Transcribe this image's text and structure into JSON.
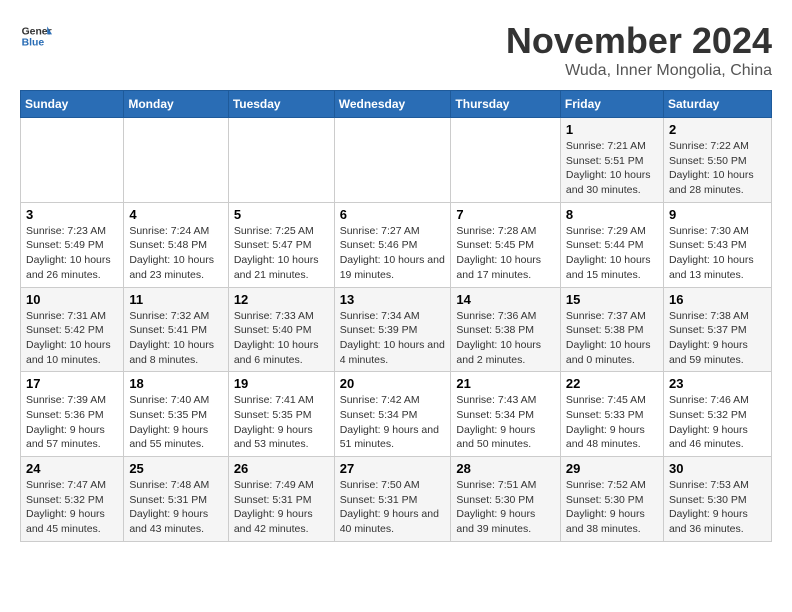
{
  "header": {
    "logo_line1": "General",
    "logo_line2": "Blue",
    "month": "November 2024",
    "location": "Wuda, Inner Mongolia, China"
  },
  "weekdays": [
    "Sunday",
    "Monday",
    "Tuesday",
    "Wednesday",
    "Thursday",
    "Friday",
    "Saturday"
  ],
  "weeks": [
    [
      {
        "day": "",
        "info": ""
      },
      {
        "day": "",
        "info": ""
      },
      {
        "day": "",
        "info": ""
      },
      {
        "day": "",
        "info": ""
      },
      {
        "day": "",
        "info": ""
      },
      {
        "day": "1",
        "info": "Sunrise: 7:21 AM\nSunset: 5:51 PM\nDaylight: 10 hours and 30 minutes."
      },
      {
        "day": "2",
        "info": "Sunrise: 7:22 AM\nSunset: 5:50 PM\nDaylight: 10 hours and 28 minutes."
      }
    ],
    [
      {
        "day": "3",
        "info": "Sunrise: 7:23 AM\nSunset: 5:49 PM\nDaylight: 10 hours and 26 minutes."
      },
      {
        "day": "4",
        "info": "Sunrise: 7:24 AM\nSunset: 5:48 PM\nDaylight: 10 hours and 23 minutes."
      },
      {
        "day": "5",
        "info": "Sunrise: 7:25 AM\nSunset: 5:47 PM\nDaylight: 10 hours and 21 minutes."
      },
      {
        "day": "6",
        "info": "Sunrise: 7:27 AM\nSunset: 5:46 PM\nDaylight: 10 hours and 19 minutes."
      },
      {
        "day": "7",
        "info": "Sunrise: 7:28 AM\nSunset: 5:45 PM\nDaylight: 10 hours and 17 minutes."
      },
      {
        "day": "8",
        "info": "Sunrise: 7:29 AM\nSunset: 5:44 PM\nDaylight: 10 hours and 15 minutes."
      },
      {
        "day": "9",
        "info": "Sunrise: 7:30 AM\nSunset: 5:43 PM\nDaylight: 10 hours and 13 minutes."
      }
    ],
    [
      {
        "day": "10",
        "info": "Sunrise: 7:31 AM\nSunset: 5:42 PM\nDaylight: 10 hours and 10 minutes."
      },
      {
        "day": "11",
        "info": "Sunrise: 7:32 AM\nSunset: 5:41 PM\nDaylight: 10 hours and 8 minutes."
      },
      {
        "day": "12",
        "info": "Sunrise: 7:33 AM\nSunset: 5:40 PM\nDaylight: 10 hours and 6 minutes."
      },
      {
        "day": "13",
        "info": "Sunrise: 7:34 AM\nSunset: 5:39 PM\nDaylight: 10 hours and 4 minutes."
      },
      {
        "day": "14",
        "info": "Sunrise: 7:36 AM\nSunset: 5:38 PM\nDaylight: 10 hours and 2 minutes."
      },
      {
        "day": "15",
        "info": "Sunrise: 7:37 AM\nSunset: 5:38 PM\nDaylight: 10 hours and 0 minutes."
      },
      {
        "day": "16",
        "info": "Sunrise: 7:38 AM\nSunset: 5:37 PM\nDaylight: 9 hours and 59 minutes."
      }
    ],
    [
      {
        "day": "17",
        "info": "Sunrise: 7:39 AM\nSunset: 5:36 PM\nDaylight: 9 hours and 57 minutes."
      },
      {
        "day": "18",
        "info": "Sunrise: 7:40 AM\nSunset: 5:35 PM\nDaylight: 9 hours and 55 minutes."
      },
      {
        "day": "19",
        "info": "Sunrise: 7:41 AM\nSunset: 5:35 PM\nDaylight: 9 hours and 53 minutes."
      },
      {
        "day": "20",
        "info": "Sunrise: 7:42 AM\nSunset: 5:34 PM\nDaylight: 9 hours and 51 minutes."
      },
      {
        "day": "21",
        "info": "Sunrise: 7:43 AM\nSunset: 5:34 PM\nDaylight: 9 hours and 50 minutes."
      },
      {
        "day": "22",
        "info": "Sunrise: 7:45 AM\nSunset: 5:33 PM\nDaylight: 9 hours and 48 minutes."
      },
      {
        "day": "23",
        "info": "Sunrise: 7:46 AM\nSunset: 5:32 PM\nDaylight: 9 hours and 46 minutes."
      }
    ],
    [
      {
        "day": "24",
        "info": "Sunrise: 7:47 AM\nSunset: 5:32 PM\nDaylight: 9 hours and 45 minutes."
      },
      {
        "day": "25",
        "info": "Sunrise: 7:48 AM\nSunset: 5:31 PM\nDaylight: 9 hours and 43 minutes."
      },
      {
        "day": "26",
        "info": "Sunrise: 7:49 AM\nSunset: 5:31 PM\nDaylight: 9 hours and 42 minutes."
      },
      {
        "day": "27",
        "info": "Sunrise: 7:50 AM\nSunset: 5:31 PM\nDaylight: 9 hours and 40 minutes."
      },
      {
        "day": "28",
        "info": "Sunrise: 7:51 AM\nSunset: 5:30 PM\nDaylight: 9 hours and 39 minutes."
      },
      {
        "day": "29",
        "info": "Sunrise: 7:52 AM\nSunset: 5:30 PM\nDaylight: 9 hours and 38 minutes."
      },
      {
        "day": "30",
        "info": "Sunrise: 7:53 AM\nSunset: 5:30 PM\nDaylight: 9 hours and 36 minutes."
      }
    ]
  ]
}
